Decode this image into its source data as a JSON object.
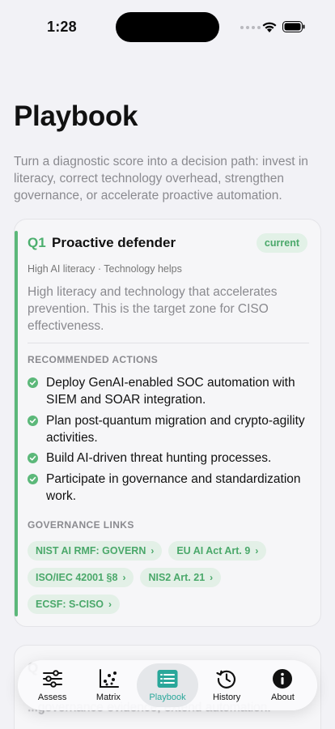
{
  "status_bar": {
    "time": "1:28"
  },
  "page": {
    "title": "Playbook",
    "subtitle": "Turn a diagnostic score into a decision path: invest in literacy, correct technology overhead, strengthen governance, or accelerate proactive automation."
  },
  "card": {
    "code": "Q1",
    "title": "Proactive defender",
    "badge": "current",
    "meta": "High AI literacy · Technology helps",
    "description": "High literacy and technology that accelerates prevention. This is the target zone for CISO effectiveness.",
    "actions_heading": "RECOMMENDED ACTIONS",
    "actions": [
      "Deploy GenAI-enabled SOC automation with SIEM and SOAR integration.",
      "Plan post-quantum migration and crypto-agility activities.",
      "Build AI-driven threat hunting processes.",
      "Participate in governance and standardization work."
    ],
    "links_heading": "GOVERNANCE LINKS",
    "links": [
      "NIST AI RMF: GOVERN",
      "EU AI Act Art. 9",
      "ISO/IEC 42001 §8",
      "NIS2 Art. 21",
      "ECSF: S-CISO"
    ]
  },
  "next_card": {
    "code": "Q",
    "description": "...governance evidence, extend automation."
  },
  "tabs": [
    {
      "label": "Assess",
      "icon": "sliders-icon"
    },
    {
      "label": "Matrix",
      "icon": "scatter-chart-icon"
    },
    {
      "label": "Playbook",
      "icon": "list-icon",
      "active": true
    },
    {
      "label": "History",
      "icon": "history-icon"
    },
    {
      "label": "About",
      "icon": "info-icon"
    }
  ],
  "colors": {
    "accent_green": "#4caf6e",
    "tab_active": "#2aa79a"
  }
}
